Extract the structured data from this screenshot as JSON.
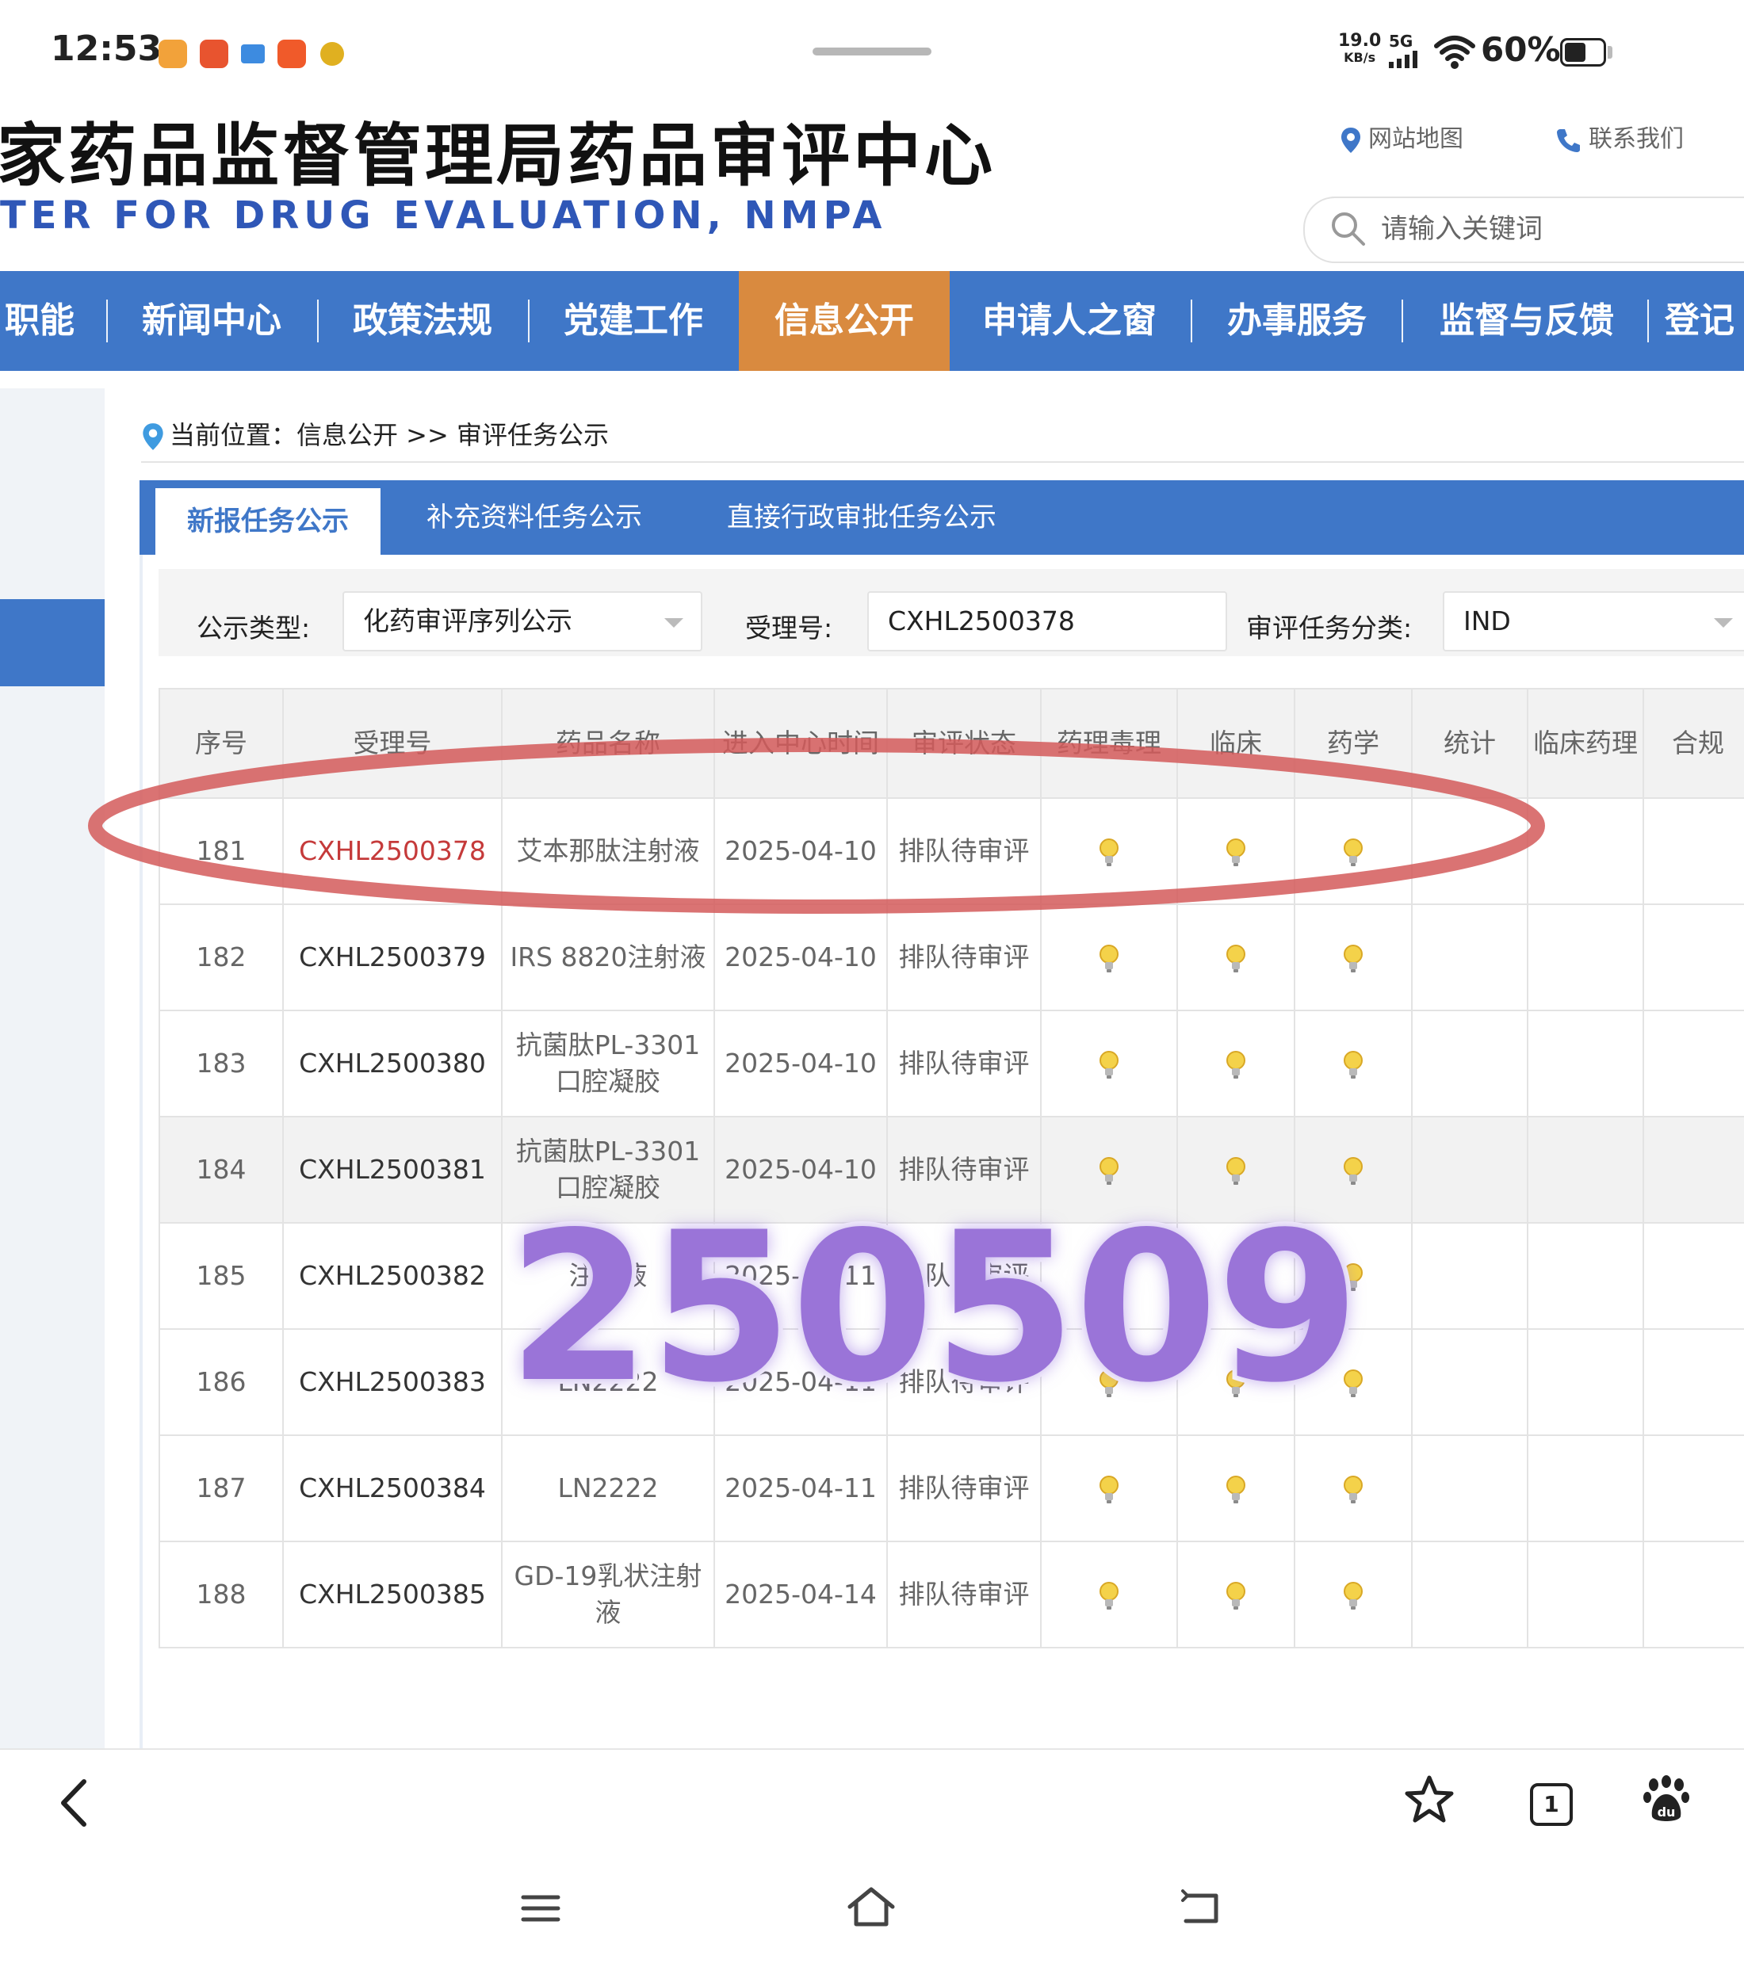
{
  "status_bar": {
    "time": "12:53",
    "net_speed_value": "19.0",
    "net_speed_unit": "KB/s",
    "network_type": "5G",
    "battery": "60%"
  },
  "site": {
    "title_zh": "家药品监督管理局药品审评中心",
    "title_en": "TER FOR DRUG EVALUATION, NMPA",
    "sitemap_label": "网站地图",
    "contact_label": "联系我们",
    "search_placeholder": "请输入关键词"
  },
  "nav": {
    "items": [
      {
        "label": "职能"
      },
      {
        "label": "新闻中心"
      },
      {
        "label": "政策法规"
      },
      {
        "label": "党建工作"
      },
      {
        "label": "信息公开",
        "active": true
      },
      {
        "label": "申请人之窗"
      },
      {
        "label": "办事服务"
      },
      {
        "label": "监督与反馈"
      },
      {
        "label": "登记"
      }
    ],
    "color": "#3f77c8",
    "active_color": "#d98a3f"
  },
  "breadcrumb": "当前位置：信息公开 >> 审评任务公示",
  "subtabs": [
    {
      "label": "新报任务公示",
      "active": true
    },
    {
      "label": "补充资料任务公示"
    },
    {
      "label": "直接行政审批任务公示"
    }
  ],
  "filters": {
    "type_label": "公示类型:",
    "type_value": "化药审评序列公示",
    "accept_label": "受理号:",
    "accept_value": "CXHL2500378",
    "category_label": "审评任务分类:",
    "category_value": "IND"
  },
  "table": {
    "headers": [
      "序号",
      "受理号",
      "药品名称",
      "进入中心时间",
      "审评状态",
      "药理毒理",
      "临床",
      "药学",
      "统计",
      "临床药理",
      "合规"
    ],
    "rows": [
      {
        "no": "181",
        "accept_no": "CXHL2500378",
        "drug": "艾本那肽注射液",
        "date": "2025-04-10",
        "status": "排队待审评",
        "highlight": true
      },
      {
        "no": "182",
        "accept_no": "CXHL2500379",
        "drug": "IRS 8820注射液",
        "date": "2025-04-10",
        "status": "排队待审评"
      },
      {
        "no": "183",
        "accept_no": "CXHL2500380",
        "drug": "抗菌肽PL-3301口腔凝胶",
        "date": "2025-04-10",
        "status": "排队待审评"
      },
      {
        "no": "184",
        "accept_no": "CXHL2500381",
        "drug": "抗菌肽PL-3301口腔凝胶",
        "date": "2025-04-10",
        "status": "排队待审评"
      },
      {
        "no": "185",
        "accept_no": "CXHL2500382",
        "drug": "注射液",
        "date": "2025-04-11",
        "status": "排队待审评"
      },
      {
        "no": "186",
        "accept_no": "CXHL2500383",
        "drug": "LN2222",
        "date": "2025-04-11",
        "status": "排队待审评"
      },
      {
        "no": "187",
        "accept_no": "CXHL2500384",
        "drug": "LN2222",
        "date": "2025-04-11",
        "status": "排队待审评"
      },
      {
        "no": "188",
        "accept_no": "CXHL2500385",
        "drug": "GD-19乳状注射液",
        "date": "2025-04-14",
        "status": "排队待审评"
      }
    ],
    "highlight_color": "#c53a3a"
  },
  "watermark": "250509",
  "browser_bar": {
    "tab_count": "1"
  },
  "icons": [
    "location-pin-icon",
    "phone-icon",
    "search-icon",
    "bulb-icon",
    "back-arrow-icon",
    "star-icon",
    "baidu-paw-icon",
    "menu-icon",
    "home-icon",
    "back-nav-icon"
  ]
}
